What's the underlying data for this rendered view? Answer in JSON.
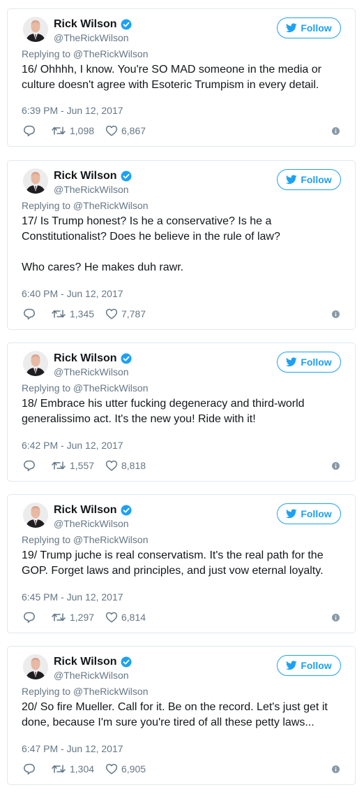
{
  "author": {
    "name": "Rick Wilson",
    "handle": "@TheRickWilson",
    "follow_label": "Follow",
    "verified": true
  },
  "colors": {
    "brand_blue": "#1da1f2",
    "secondary_text": "#657786",
    "primary_text": "#14171a",
    "border": "#e1e8ed"
  },
  "icons": {
    "reply": "reply-icon",
    "retweet": "retweet-icon",
    "like": "heart-icon",
    "more": "info-icon",
    "verified": "verified-badge-icon",
    "follow": "twitter-bird-icon"
  },
  "tweets": [
    {
      "reply_to": "Replying to @TheRickWilson",
      "text": "16/ Ohhhh, I know. You're SO MAD someone in the media or culture doesn't agree with Esoteric Trumpism in every detail.",
      "timestamp": "6:39 PM - Jun 12, 2017",
      "retweets": "1,098",
      "likes": "6,867"
    },
    {
      "reply_to": "Replying to @TheRickWilson",
      "text": "17/ Is Trump honest? Is he a conservative? Is he a Constitutionalist? Does he believe in the rule of law?\n\nWho cares? He makes duh rawr.",
      "timestamp": "6:40 PM - Jun 12, 2017",
      "retweets": "1,345",
      "likes": "7,787"
    },
    {
      "reply_to": "Replying to @TheRickWilson",
      "text": "18/ Embrace his utter fucking degeneracy and third-world generalissimo act. It's the new you! Ride with it!",
      "timestamp": "6:42 PM - Jun 12, 2017",
      "retweets": "1,557",
      "likes": "8,818"
    },
    {
      "reply_to": "Replying to @TheRickWilson",
      "text": "19/ Trump juche is real conservatism. It's the real path for the GOP. Forget laws and principles, and just vow eternal loyalty.",
      "timestamp": "6:45 PM - Jun 12, 2017",
      "retweets": "1,297",
      "likes": "6,814"
    },
    {
      "reply_to": "Replying to @TheRickWilson",
      "text": "20/ So fire Mueller. Call for it. Be on the record. Let's just get it done, because I'm sure you're tired of all these petty laws...",
      "timestamp": "6:47 PM - Jun 12, 2017",
      "retweets": "1,304",
      "likes": "6,905"
    }
  ]
}
